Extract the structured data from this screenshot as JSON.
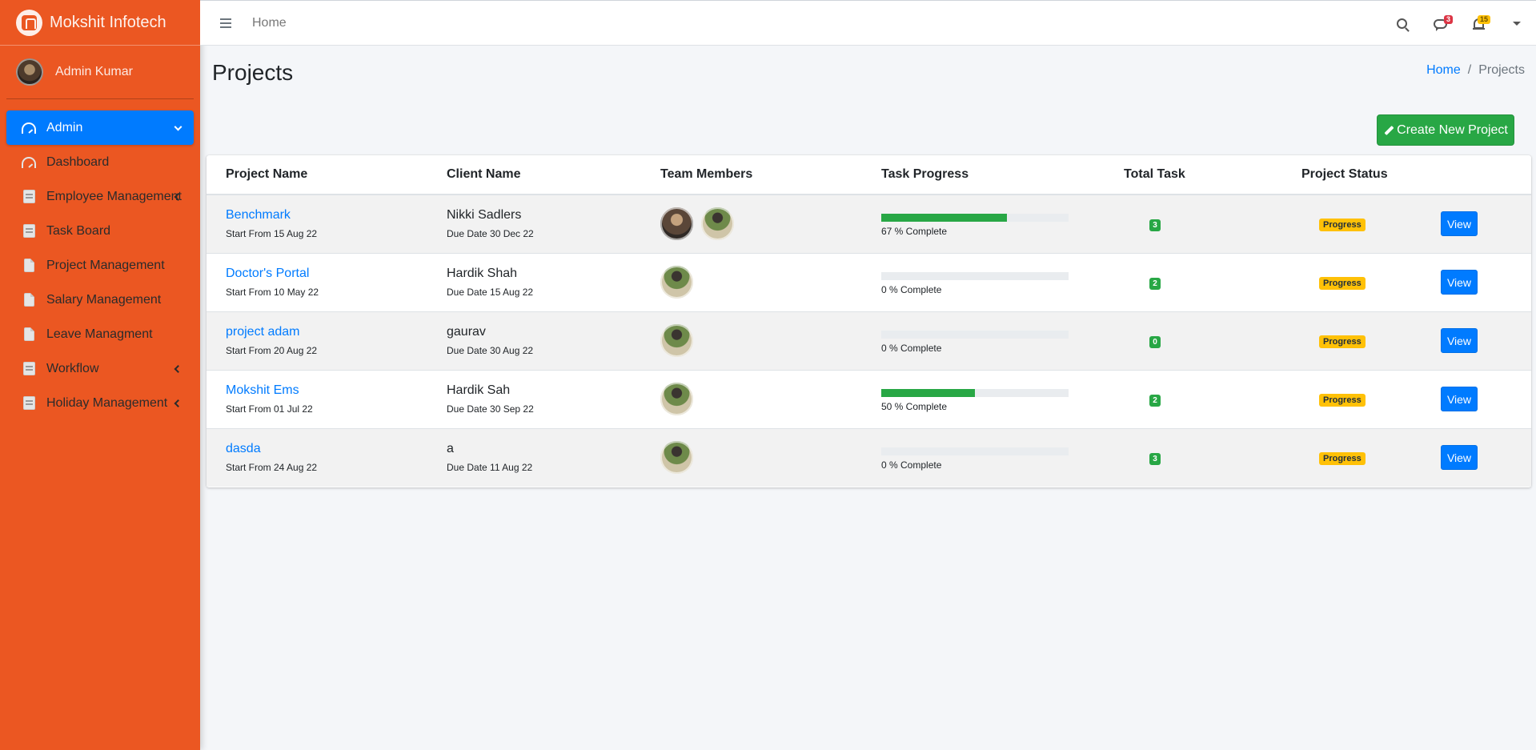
{
  "brand": {
    "name": "Mokshit Infotech"
  },
  "user": {
    "name": "Admin Kumar"
  },
  "sidebar": {
    "items": [
      {
        "label": "Admin",
        "icon": "gauge-icon",
        "active": true,
        "chevron": "down"
      },
      {
        "label": "Dashboard",
        "icon": "gauge-icon"
      },
      {
        "label": "Employee Management",
        "icon": "book-icon",
        "chevron": "left"
      },
      {
        "label": "Task Board",
        "icon": "book-icon"
      },
      {
        "label": "Project Management",
        "icon": "file-icon"
      },
      {
        "label": "Salary Management",
        "icon": "file-icon"
      },
      {
        "label": "Leave Managment",
        "icon": "file-icon"
      },
      {
        "label": "Workflow",
        "icon": "book-icon",
        "chevron": "left"
      },
      {
        "label": "Holiday Management",
        "icon": "book-icon",
        "chevron": "left"
      }
    ]
  },
  "topbar": {
    "home_label": "Home",
    "messages_count": "3",
    "notifications_count": "15"
  },
  "page": {
    "title": "Projects",
    "breadcrumb": {
      "home": "Home",
      "separator": "/",
      "current": "Projects"
    },
    "create_label": "Create New Project"
  },
  "table": {
    "headers": [
      "Project Name",
      "Client Name",
      "Team Members",
      "Task Progress",
      "Total Task",
      "Project Status"
    ],
    "rows": [
      {
        "name": "Benchmark",
        "start": "Start From 15 Aug 22",
        "client": "Nikki Sadlers",
        "due": "Due Date 30 Dec 22",
        "members": 2,
        "progress": 67,
        "progress_text": "67 % Complete",
        "total": "3",
        "status": "Progress",
        "action": "View"
      },
      {
        "name": "Doctor's Portal",
        "start": "Start From 10 May 22",
        "client": "Hardik Shah",
        "due": "Due Date 15 Aug 22",
        "members": 1,
        "progress": 0,
        "progress_text": "0 % Complete",
        "total": "2",
        "status": "Progress",
        "action": "View"
      },
      {
        "name": "project adam",
        "start": "Start From 20 Aug 22",
        "client": "gaurav",
        "due": "Due Date 30 Aug 22",
        "members": 1,
        "progress": 0,
        "progress_text": "0 % Complete",
        "total": "0",
        "status": "Progress",
        "action": "View"
      },
      {
        "name": "Mokshit Ems",
        "start": "Start From 01 Jul 22",
        "client": "Hardik Sah",
        "due": "Due Date 30 Sep 22",
        "members": 1,
        "progress": 50,
        "progress_text": "50 % Complete",
        "total": "2",
        "status": "Progress",
        "action": "View"
      },
      {
        "name": "dasda",
        "start": "Start From 24 Aug 22",
        "client": "a",
        "due": "Due Date 11 Aug 22",
        "members": 1,
        "progress": 0,
        "progress_text": "0 % Complete",
        "total": "3",
        "status": "Progress",
        "action": "View"
      }
    ]
  },
  "colors": {
    "sidebar": "#eb5722",
    "primary": "#007bff",
    "success": "#28a745",
    "warning": "#ffc107",
    "danger": "#dc3545"
  }
}
